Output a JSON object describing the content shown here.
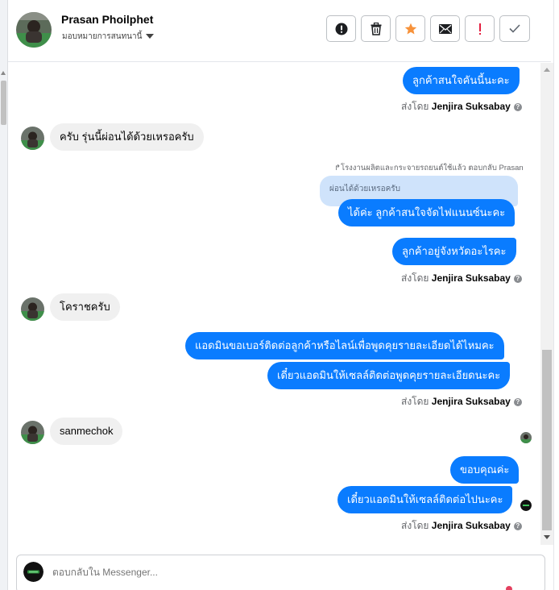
{
  "header": {
    "contact_name": "Prasan Phoilphet",
    "assign_label": "มอบหมายการสนทนานี้"
  },
  "actions": [
    {
      "name": "mark-spam",
      "icon": "alert-circle-icon"
    },
    {
      "name": "delete",
      "icon": "trash-icon"
    },
    {
      "name": "star",
      "icon": "star-icon"
    },
    {
      "name": "mark-unread",
      "icon": "envelope-icon"
    },
    {
      "name": "follow-up",
      "icon": "exclamation-icon"
    },
    {
      "name": "mark-done",
      "icon": "check-icon"
    }
  ],
  "colors": {
    "outgoing_bubble": "#0a7cff",
    "incoming_bubble": "#f0f0f0",
    "star": "#f7923a",
    "flag": "#e41e3f"
  },
  "messages": {
    "m1": "ลูกค้าสนใจคันนี้นะคะ",
    "m2": "ครับ รุ่นนี้ผ่อนได้ด้วยเหรอครับ",
    "reply_note": "↱โรงงานผลิตและกระจายรถยนต์ใช้แล้ว ตอบกลับ Prasan",
    "quoted_text": "ผ่อนได้ด้วยเหรอครับ",
    "m3": "ได้ค่ะ ลูกค้าสนใจจัดไฟแนนซ์นะคะ",
    "m4": "ลูกค้าอยู่จังหวัดอะไรคะ",
    "m5": "โคราชครับ",
    "m6": "แอดมินขอเบอร์ติดต่อลูกค้าหรือไลน์เพื่อพูดคุยรายละเอียดได้ไหมคะ",
    "m7": "เดี๋ยวแอดมินให้เซลล์ติดต่อพูดคุยรายละเอียดนะคะ",
    "m8": "sanmechok",
    "m9": "ขอบคุณค่ะ",
    "m10": "เดี๋ยวแอดมินให้เซลล์ติดต่อไปนะคะ"
  },
  "sent_by": {
    "prefix": "ส่งโดย",
    "agent": "Jenjira Suksabay"
  },
  "composer": {
    "placeholder": "ตอบกลับใน Messenger..."
  }
}
